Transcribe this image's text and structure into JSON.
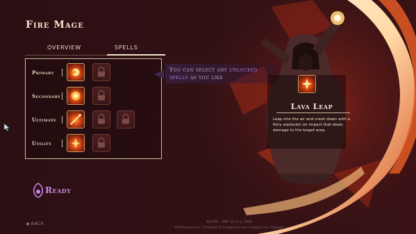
{
  "title": "Fire Mage",
  "tabs": {
    "overview": "OVERVIEW",
    "spells": "SPELLS"
  },
  "rows": [
    {
      "label": "Primary"
    },
    {
      "label": "Secondary"
    },
    {
      "label": "Ultimate"
    },
    {
      "label": "Utility"
    }
  ],
  "callout": {
    "line1_a": "You can select any ",
    "line1_hl": "unlocked",
    "line2_hl": "spells",
    "line2_b": " as you like"
  },
  "spell_detail": {
    "name": "Lava Leap",
    "description": "Leap into the air and crash down with a fiery explosion on impact that deals damage to the target area."
  },
  "ready_label": "Ready",
  "back_label": "BACK",
  "footer": {
    "build": "BoTM - WIP v0.0.1_568",
    "notice": "Performance, Content & Graphics are subject to change"
  },
  "colors": {
    "accent_purple": "#b779e8",
    "panel_border": "#d3c2a3",
    "fire_orange": "#ff8a2c",
    "background": "#2b0f13"
  },
  "icons": {
    "slot_active": "fire-spell-icon",
    "slot_locked": "padlock-icon",
    "ready": "class-emblem-icon",
    "cursor": "pointer-cursor-icon"
  }
}
